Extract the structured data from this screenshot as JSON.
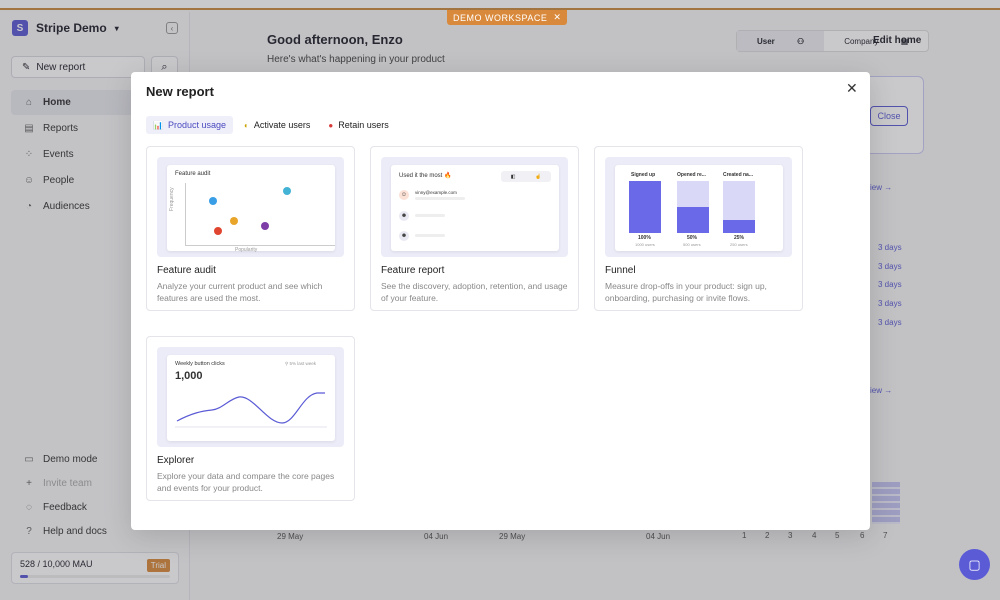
{
  "banner": {
    "label": "DEMO WORKSPACE",
    "close": "✕"
  },
  "sidebar": {
    "workspace": "Stripe Demo",
    "logo_letter": "S",
    "new_report": "New report",
    "items": [
      {
        "label": "Home",
        "icon": "home-icon",
        "active": true
      },
      {
        "label": "Reports",
        "icon": "reports-icon"
      },
      {
        "label": "Events",
        "icon": "events-icon"
      },
      {
        "label": "People",
        "icon": "people-icon"
      },
      {
        "label": "Audiences",
        "icon": "audiences-icon"
      }
    ],
    "bottom": [
      {
        "label": "Demo mode",
        "icon": "folder-icon"
      },
      {
        "label": "Invite team",
        "icon": "plus-icon",
        "dim": true
      },
      {
        "label": "Feedback",
        "icon": "feedback-icon"
      },
      {
        "label": "Help and docs",
        "icon": "help-icon"
      }
    ],
    "mau": "528 / 10,000 MAU",
    "mau_fraction": 0.0528,
    "trial": "Trial"
  },
  "main": {
    "greeting": "Good afternoon, Enzo",
    "subtitle": "Here's what's happening in your product",
    "toggle_user": "User",
    "toggle_company": "Company",
    "edit_home": "Edit home",
    "close": "Close",
    "days": [
      "3 days",
      "3 days",
      "3 days",
      "3 days",
      "3 days"
    ],
    "view": "iew →",
    "dates": [
      "29 May",
      "04 Jun",
      "29 May",
      "04 Jun"
    ],
    "nums": [
      "1",
      "2",
      "3",
      "4",
      "5",
      "6",
      "7"
    ]
  },
  "modal": {
    "title": "New report",
    "tabs": [
      {
        "label": "Product usage",
        "icon": "📊",
        "active": true
      },
      {
        "label": "Activate users",
        "icon": "◐"
      },
      {
        "label": "Retain users",
        "icon": "●"
      }
    ],
    "cards": [
      {
        "title": "Feature audit",
        "desc": "Analyze your current product and see which features are used the most.",
        "preview_title": "Feature audit",
        "y_axis": "Frequency",
        "x_axis": "Popularity"
      },
      {
        "title": "Feature report",
        "desc": "See the discovery, adoption, retention, and usage of your feature.",
        "preview_title": "Used it the most 🔥",
        "email": "vinny@example.com"
      },
      {
        "title": "Funnel",
        "desc": "Measure drop-offs in your product: sign up, onboarding, purchasing or invite flows.",
        "steps": [
          {
            "label": "Signed up",
            "pct": "100%",
            "sub": "1000 users",
            "value": 1.0
          },
          {
            "label": "Opened re...",
            "pct": "50%",
            "sub": "500 users",
            "value": 0.5
          },
          {
            "label": "Created na...",
            "pct": "25%",
            "sub": "250 users",
            "value": 0.25
          }
        ]
      },
      {
        "title": "Explorer",
        "desc": "Explore your data and compare the core pages and events for your product.",
        "preview_title": "Weekly button clicks",
        "value": "1,000",
        "legend": "5% last week"
      }
    ]
  }
}
